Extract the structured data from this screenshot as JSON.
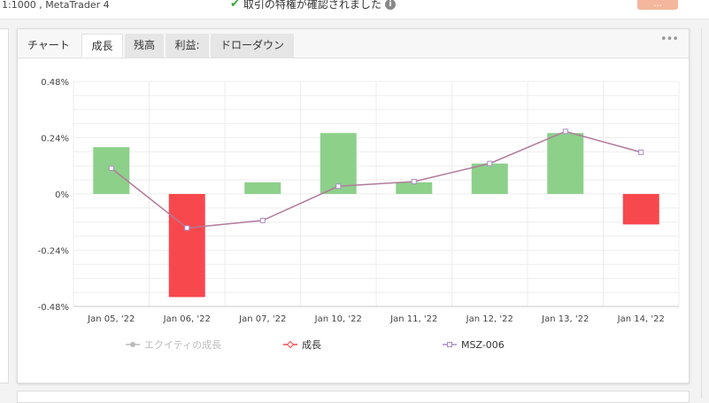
{
  "top": {
    "account_info": "1:1000 , MetaTrader 4",
    "verified_text": "取引の特権が確認されました",
    "button_label": "..."
  },
  "tabs": [
    {
      "label": "チャート",
      "active": false
    },
    {
      "label": "成長",
      "active": true
    },
    {
      "label": "残高",
      "active": false
    },
    {
      "label": "利益:",
      "active": false
    },
    {
      "label": "ドローダウン",
      "active": false
    }
  ],
  "menu_label": "•••",
  "colors": {
    "positive": "#8dd08a",
    "negative": "#f7484e",
    "line": "#b27a9b",
    "marker": "#a98bc7",
    "disabled": "#bbbbbb"
  },
  "chart_data": {
    "type": "bar",
    "categories": [
      "Jan 05, '22",
      "Jan 06, '22",
      "Jan 07, '22",
      "Jan 10, '22",
      "Jan 11, '22",
      "Jan 12, '22",
      "Jan 13, '22",
      "Jan 14, '22"
    ],
    "ylim": [
      -0.48,
      0.48
    ],
    "yticks": [
      0.48,
      0.24,
      0,
      -0.24,
      -0.48
    ],
    "ytick_labels": [
      "0.48%",
      "0.24%",
      "0%",
      "-0.24%",
      "-0.48%"
    ],
    "series": [
      {
        "name": "エクイティの成長",
        "type": "line",
        "visible": false,
        "values": []
      },
      {
        "name": "成長",
        "type": "bar",
        "values": [
          0.2,
          -0.44,
          0.05,
          0.26,
          0.05,
          0.13,
          0.26,
          -0.13
        ]
      },
      {
        "name": "MSZ-006",
        "type": "line",
        "values": [
          0.11,
          -0.145,
          -0.113,
          0.033,
          0.053,
          0.13,
          0.267,
          0.178
        ]
      }
    ],
    "legend_position": "bottom"
  }
}
